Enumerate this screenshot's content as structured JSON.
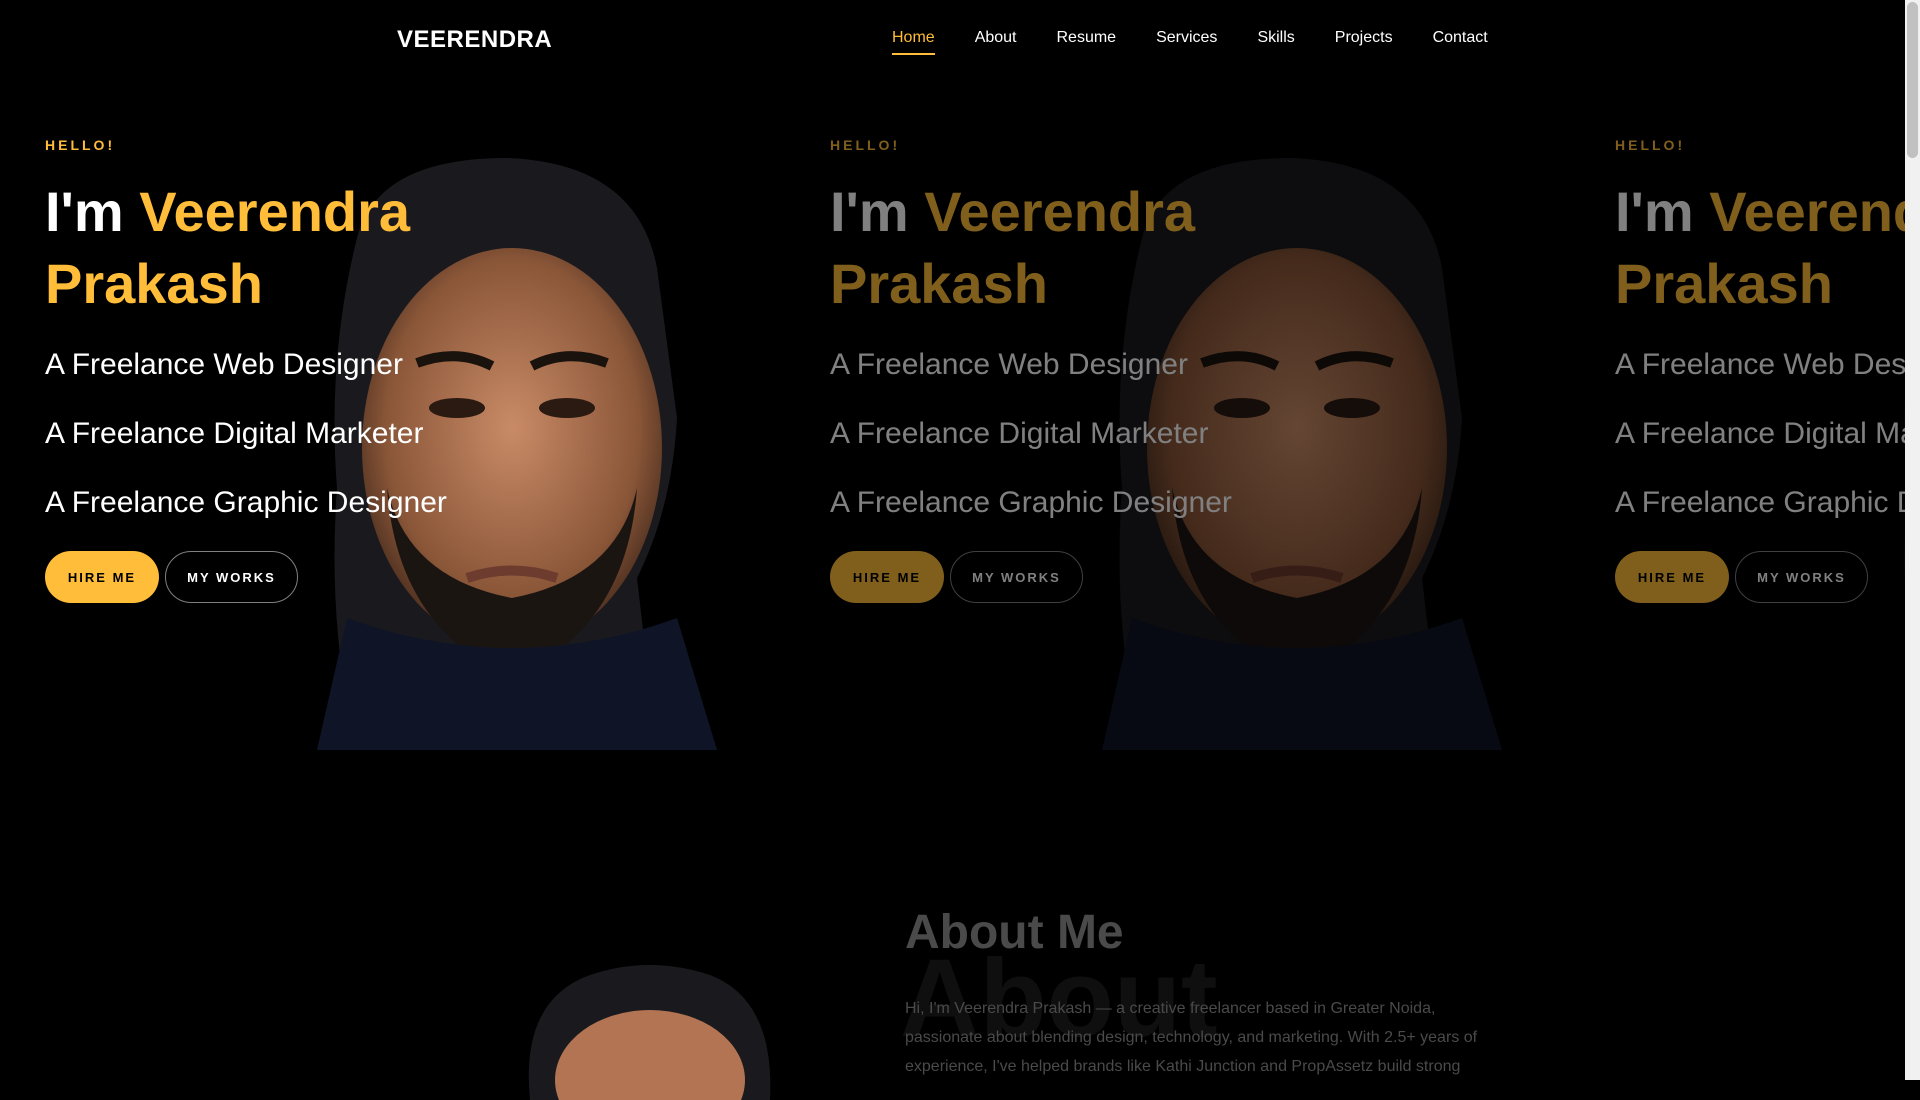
{
  "brand": "VEERENDRA",
  "nav": {
    "items": [
      {
        "label": "Home",
        "active": true
      },
      {
        "label": "About",
        "active": false
      },
      {
        "label": "Resume",
        "active": false
      },
      {
        "label": "Services",
        "active": false
      },
      {
        "label": "Skills",
        "active": false
      },
      {
        "label": "Projects",
        "active": false
      },
      {
        "label": "Contact",
        "active": false
      }
    ]
  },
  "hero": {
    "greeting": "HELLO!",
    "title_prefix": "I'm ",
    "title_name": "Veerendra Prakash",
    "roles": [
      "A Freelance Web Designer",
      "A Freelance Digital Marketer",
      "A Freelance Graphic Designer"
    ],
    "hire_label": "HIRE ME",
    "works_label": "MY WORKS"
  },
  "about": {
    "bg_word": "About",
    "title": "About Me",
    "text": "Hi, I'm Veerendra Prakash — a creative freelancer based in Greater Noida, passionate about blending design, technology, and marketing. With 2.5+ years of experience, I've helped brands like Kathi Junction and PropAssetz build strong"
  },
  "colors": {
    "accent": "#ffbd39",
    "background": "#000000"
  },
  "icons": {
    "portrait": "person-portrait-image"
  }
}
